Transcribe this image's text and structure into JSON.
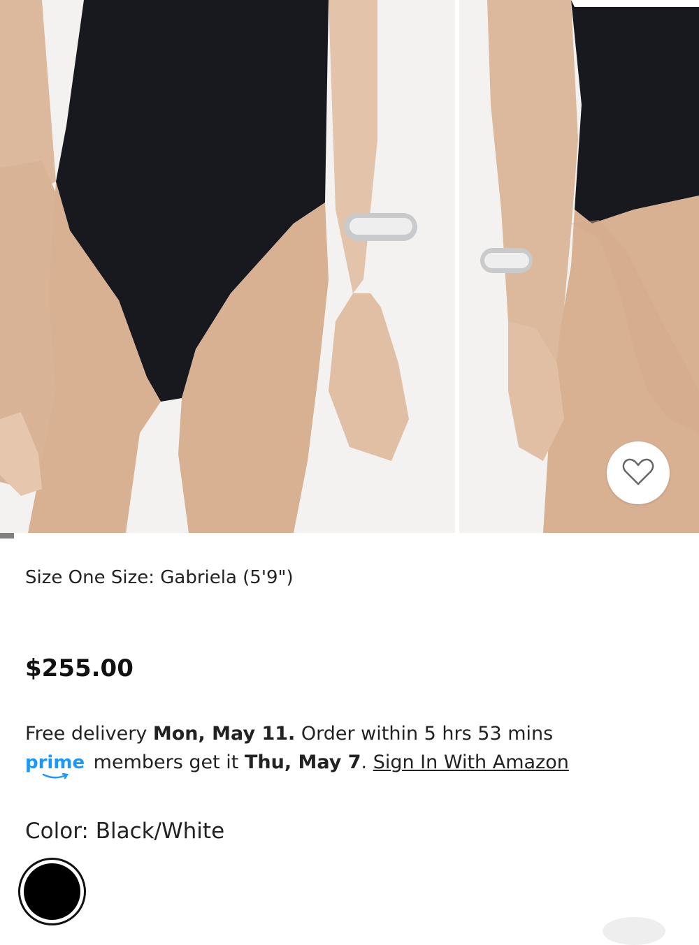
{
  "gallery": {
    "images": [
      {
        "name": "front-view",
        "alt": ""
      },
      {
        "name": "back-view",
        "alt": ""
      }
    ],
    "favorite_icon": "heart-outline-icon"
  },
  "product": {
    "size_line": "Size One Size: Gabriela (5'9\")",
    "price": "$255.00",
    "color_label": "Color: Black/White",
    "swatch_color": "#000000"
  },
  "delivery": {
    "prefix": "Free delivery ",
    "date": "Mon, May 11.",
    "suffix": " Order within 5 hrs 53 mins"
  },
  "prime": {
    "logo": "prime",
    "text1": " members get it ",
    "date": "Thu, May 7",
    "text2": ". ",
    "signin": "Sign In With Amazon",
    "brand_color": "#1a98ff"
  }
}
